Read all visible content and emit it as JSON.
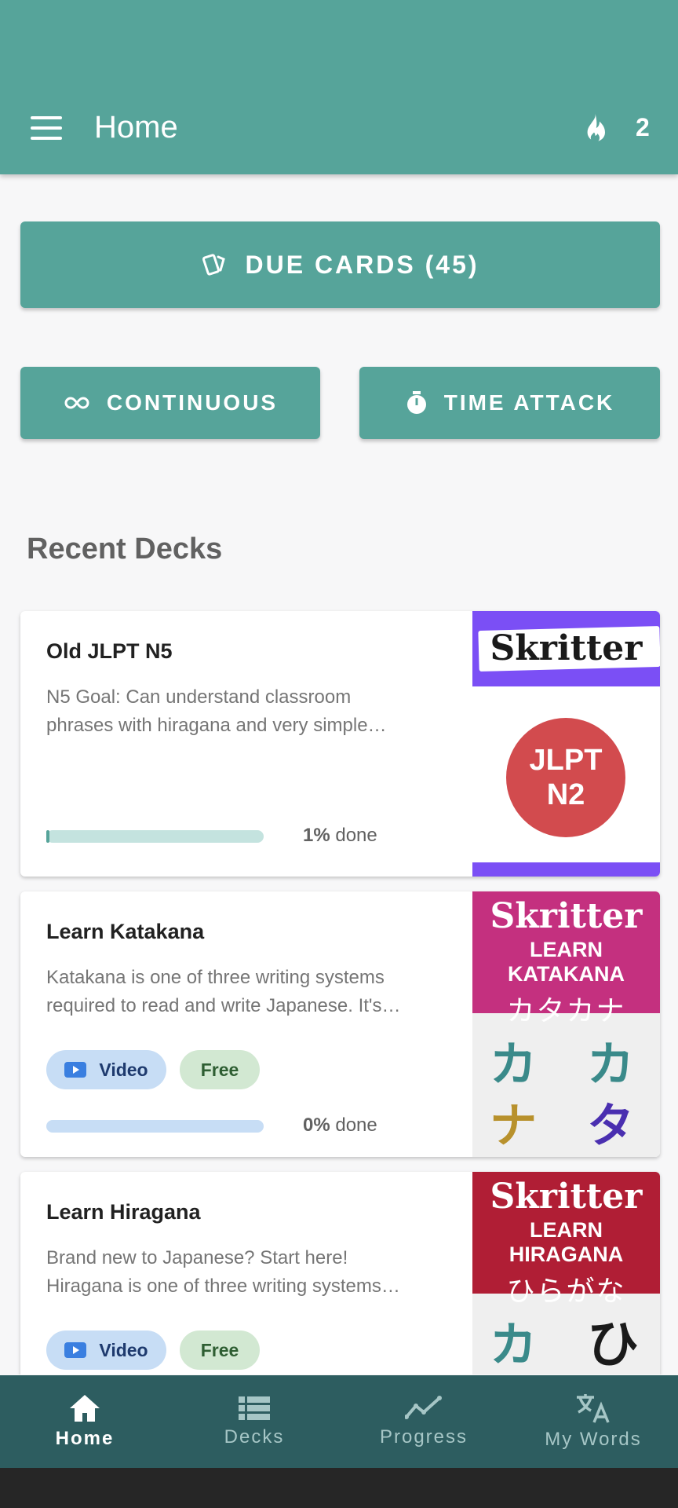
{
  "app_bar": {
    "title": "Home",
    "streak_count": "2"
  },
  "actions": {
    "due_cards": "DUE CARDS (45)",
    "continuous": "CONTINUOUS",
    "time_attack": "TIME ATTACK"
  },
  "recent_decks_title": "Recent Decks",
  "decks": [
    {
      "title": "Old JLPT N5",
      "desc_line1": "N5 Goal: Can understand classroom",
      "desc_line2": "phrases with hiragana and very simple…",
      "progress_pct": "1%",
      "progress_value": 0.01,
      "done_label": "done",
      "thumb_brand": "Skritter",
      "thumb_badge_line1": "JLPT",
      "thumb_badge_line2": "N2"
    },
    {
      "title": "Learn Katakana",
      "desc_line1": "Katakana is one of three writing systems",
      "desc_line2": "required to read and write Japanese. It's…",
      "chip_video": "Video",
      "chip_free": "Free",
      "progress_pct": "0%",
      "progress_value": 0,
      "done_label": "done",
      "thumb_brand": "Skritter",
      "thumb_sub": "LEARN KATAKANA",
      "thumb_kana": "カタカナ",
      "thumb_glyphs": [
        "カ",
        "カ",
        "ナ",
        "タ"
      ]
    },
    {
      "title": "Learn Hiragana",
      "desc_line1": "Brand new to Japanese? Start here!",
      "desc_line2": "Hiragana is one of three writing systems…",
      "chip_video": "Video",
      "chip_free": "Free",
      "thumb_brand": "Skritter",
      "thumb_sub": "LEARN HIRAGANA",
      "thumb_kana": "ひらがな",
      "thumb_glyphs": [
        "カ",
        "ひ"
      ]
    }
  ],
  "bottom_nav": [
    {
      "label": "Home",
      "icon": "home-icon",
      "active": true
    },
    {
      "label": "Decks",
      "icon": "list-icon",
      "active": false
    },
    {
      "label": "Progress",
      "icon": "trend-icon",
      "active": false
    },
    {
      "label": "My Words",
      "icon": "translate-icon",
      "active": false
    }
  ],
  "colors": {
    "primary": "#56a49a",
    "bottom_nav": "#2d5d60",
    "katakana_thumb": "#c4307f",
    "hiragana_thumb": "#b01e35",
    "jlpt_thumb": "#7b4ff5",
    "jlpt_badge": "#d24b4e"
  }
}
